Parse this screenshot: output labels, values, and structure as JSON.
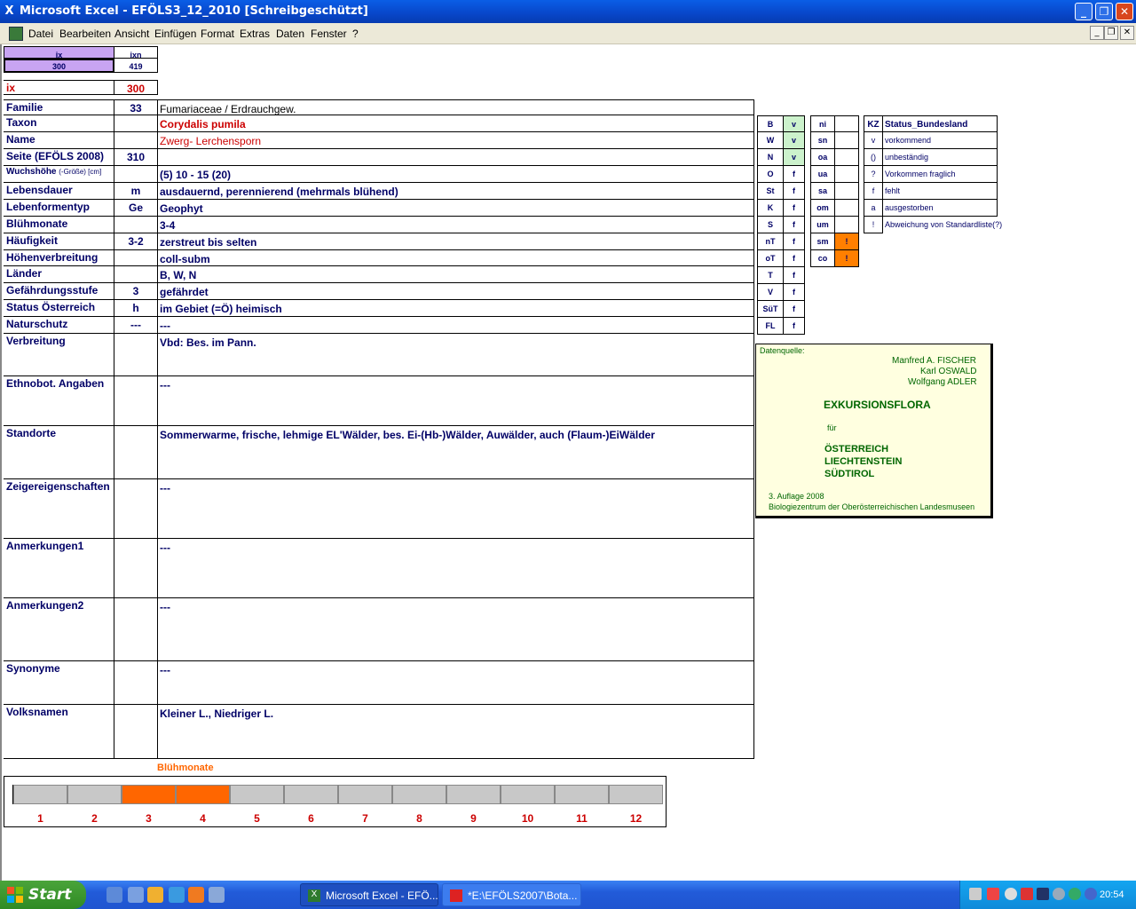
{
  "window": {
    "title": "Microsoft Excel - EFÖLS3_12_2010  [Schreibgeschützt]",
    "app_icon": "excel-icon"
  },
  "menu": [
    "Datei",
    "Bearbeiten",
    "Ansicht",
    "Einfügen",
    "Format",
    "Extras",
    "Daten",
    "Fenster",
    "?"
  ],
  "index_box": {
    "h1": "ix",
    "h2": "ixn",
    "v1": "300",
    "v2": "419"
  },
  "ix": {
    "label": "ix",
    "value": "300"
  },
  "fields": [
    {
      "label": "Familie",
      "num": "33",
      "value": "Fumariaceae  /  Erdrauchgew."
    },
    {
      "label": "Taxon",
      "num": "",
      "value": "Corydalis pumila"
    },
    {
      "label": "Name",
      "num": "",
      "value": "Zwerg- Lerchensporn"
    },
    {
      "label": "Seite (EFÖLS 2008)",
      "num": "310",
      "value": ""
    },
    {
      "label": "Wuchshöhe",
      "label_small": "(-Größe) [cm]",
      "num": "",
      "value": " (5) 10 - 15 (20)"
    },
    {
      "label": "Lebensdauer",
      "num": "m",
      "value": "ausdauernd, perennierend (mehrmals blühend)"
    },
    {
      "label": "Lebenformentyp",
      "num": "Ge",
      "value": "Geophyt"
    },
    {
      "label": "Blühmonate",
      "num": "",
      "value": " 3-4"
    },
    {
      "label": "Häufigkeit",
      "num": "3-2",
      "value": "zerstreut bis selten"
    },
    {
      "label": "Höhenverbreitung",
      "num": "",
      "value": "coll-subm"
    },
    {
      "label": "Länder",
      "num": "",
      "value": "B, W, N"
    },
    {
      "label": "Gefährdungsstufe",
      "num": "3",
      "value": "gefährdet"
    },
    {
      "label": "Status Österreich",
      "num": "h",
      "value": "im Gebiet (=Ö) heimisch"
    },
    {
      "label": "Naturschutz",
      "num": "---",
      "value": " ---"
    },
    {
      "label": "Verbreitung",
      "num": "",
      "value": "Vbd: Bes. im Pann."
    },
    {
      "label": "Ethnobot. Angaben",
      "num": "",
      "value": "---"
    },
    {
      "label": "Standorte",
      "num": "",
      "value": "Sommerwarme, frische, lehmige EL'Wälder, bes. Ei-(Hb-)Wälder, Auwälder, auch (Flaum-)EiWälder"
    },
    {
      "label": "Zeigereigenschaften",
      "num": "",
      "value": "---"
    },
    {
      "label": "Anmerkungen1",
      "num": "",
      "value": "---"
    },
    {
      "label": "Anmerkungen2",
      "num": "",
      "value": "---"
    },
    {
      "label": "Synonyme",
      "num": "",
      "value": "---"
    },
    {
      "label": "Volksnamen",
      "num": "",
      "value": "Kleiner L., Niedriger L."
    }
  ],
  "states": [
    {
      "code": "B",
      "status": "v",
      "green": true
    },
    {
      "code": "W",
      "status": "v",
      "green": true
    },
    {
      "code": "N",
      "status": "v",
      "green": true
    },
    {
      "code": "O",
      "status": "f"
    },
    {
      "code": "St",
      "status": "f"
    },
    {
      "code": "K",
      "status": "f"
    },
    {
      "code": "S",
      "status": "f"
    },
    {
      "code": "nT",
      "status": "f"
    },
    {
      "code": "oT",
      "status": "f"
    },
    {
      "code": "T",
      "status": "f"
    },
    {
      "code": "V",
      "status": "f"
    },
    {
      "code": "SüT",
      "status": "f"
    },
    {
      "code": "FL",
      "status": "f"
    }
  ],
  "altitudes": [
    {
      "code": "ni",
      "mark": ""
    },
    {
      "code": "sn",
      "mark": ""
    },
    {
      "code": "oa",
      "mark": ""
    },
    {
      "code": "ua",
      "mark": ""
    },
    {
      "code": "sa",
      "mark": ""
    },
    {
      "code": "om",
      "mark": ""
    },
    {
      "code": "um",
      "mark": ""
    },
    {
      "code": "sm",
      "mark": "!",
      "orange": true
    },
    {
      "code": "co",
      "mark": "!",
      "orange": true
    }
  ],
  "legend": {
    "h1": "KZ",
    "h2": "Status_Bundesland",
    "rows": [
      {
        "k": "v",
        "t": "vorkommend"
      },
      {
        "k": "()",
        "t": "unbeständig"
      },
      {
        "k": "?",
        "t": "Vorkommen fraglich"
      },
      {
        "k": "f",
        "t": "fehlt"
      },
      {
        "k": "a",
        "t": "ausgestorben"
      },
      {
        "k": "!",
        "t": "Abweichung von Standardliste(?)"
      }
    ]
  },
  "source": {
    "label": "Datenquelle:",
    "author1": "Manfred A. FISCHER",
    "author2": "Karl OSWALD",
    "author3": "Wolfgang ADLER",
    "title": "EXKURSIONSFLORA",
    "fuer": "für",
    "c1": "ÖSTERREICH",
    "c2": "LIECHTENSTEIN",
    "c3": "SÜDTIROL",
    "edition": "3. Auflage 2008",
    "publisher": "Biologiezentrum der Oberösterreichischen Landesmuseen"
  },
  "bloom": {
    "header": "Blühmonate",
    "months": [
      "1",
      "2",
      "3",
      "4",
      "5",
      "6",
      "7",
      "8",
      "9",
      "10",
      "11",
      "12"
    ],
    "active": [
      3,
      4
    ],
    "active_color": "#ff6600"
  },
  "taskbar": {
    "start": "Start",
    "task1": "Microsoft Excel - EFÖ...",
    "task2": "*E:\\EFÖLS2007\\Bota...",
    "time": "20:54"
  }
}
